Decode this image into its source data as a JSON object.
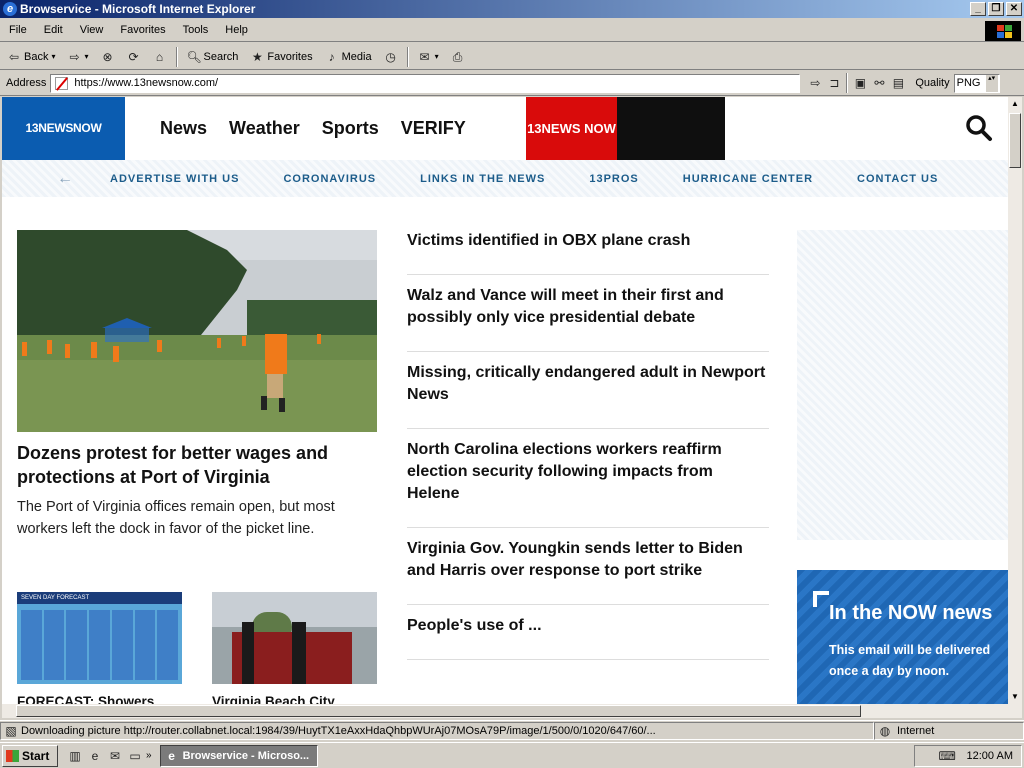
{
  "window": {
    "title": "Browservice - Microsoft Internet Explorer"
  },
  "menu": [
    "File",
    "Edit",
    "View",
    "Favorites",
    "Tools",
    "Help"
  ],
  "toolbar": {
    "back_label": "Back",
    "search_label": "Search",
    "favorites_label": "Favorites",
    "media_label": "Media"
  },
  "address": {
    "label": "Address",
    "url": "https://www.13newsnow.com/",
    "quality_label": "Quality",
    "quality_value": "PNG"
  },
  "site": {
    "logo": "13NEWSNOW",
    "nav": [
      "News",
      "Weather",
      "Sports",
      "VERIFY"
    ],
    "plus_badge": "13NEWS NOW +",
    "subnav": [
      "ADVERTISE WITH US",
      "CORONAVIRUS",
      "LINKS IN THE NEWS",
      "13PROS",
      "HURRICANE CENTER",
      "CONTACT US"
    ],
    "hero": {
      "title": "Dozens protest for better wages and protections at Port of Virginia",
      "description": "The Port of Virginia offices remain open, but most workers left the dock in favor of the picket line."
    },
    "thumbs": [
      {
        "caption": "FORECAST: Showers",
        "banner": "SEVEN DAY FORECAST"
      },
      {
        "caption": "Virginia Beach City"
      }
    ],
    "stories": [
      "Victims identified in OBX plane crash",
      "Walz and Vance will meet in their first and possibly only vice presidential debate",
      "Missing, critically endangered adult in Newport News",
      "North Carolina elections workers reaffirm election security following impacts from Helene",
      "Virginia Gov. Youngkin sends letter to Biden and Harris over response to port strike",
      "People's use of ..."
    ],
    "promo": {
      "title": "In the NOW news",
      "text": "This email will be delivered once a day by noon."
    }
  },
  "status": {
    "text": "Downloading picture http://router.collabnet.local:1984/39/HuytTX1eAxxHdaQhbpWUrAj07MOsA79P/image/1/500/0/1020/647/60/...",
    "zone": "Internet"
  },
  "taskbar": {
    "start_label": "Start",
    "task_label": "Browservice - Microso...",
    "clock": "12:00 AM"
  }
}
